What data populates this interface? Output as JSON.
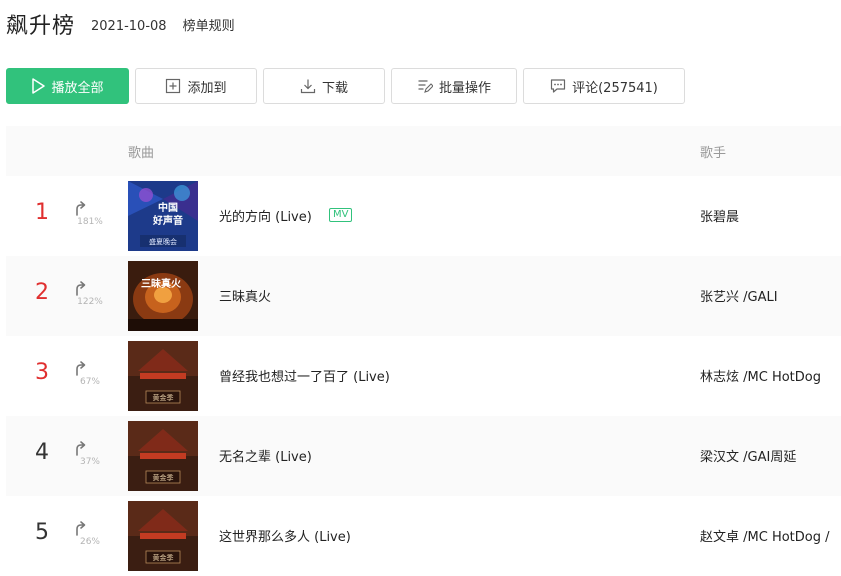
{
  "header": {
    "title": "飙升榜",
    "date": "2021-10-08",
    "rules_label": "榜单规则"
  },
  "toolbar": {
    "play_all": "播放全部",
    "add_to": "添加到",
    "download": "下载",
    "batch": "批量操作",
    "comment": "评论(257541)"
  },
  "list": {
    "col_song": "歌曲",
    "col_artist": "歌手",
    "rows": [
      {
        "rank": "1",
        "pct": "181%",
        "title": "光的方向 (Live)",
        "mv": "MV",
        "artist": "张碧晨"
      },
      {
        "rank": "2",
        "pct": "122%",
        "title": "三昧真火",
        "mv": "",
        "artist": "张艺兴 /GALI"
      },
      {
        "rank": "3",
        "pct": "67%",
        "title": "曾经我也想过一了百了 (Live)",
        "mv": "",
        "artist": "林志炫 /MC HotDog"
      },
      {
        "rank": "4",
        "pct": "37%",
        "title": "无名之辈 (Live)",
        "mv": "",
        "artist": "梁汉文 /GAI周延"
      },
      {
        "rank": "5",
        "pct": "26%",
        "title": "这世界那么多人 (Live)",
        "mv": "",
        "artist": "赵文卓 /MC HotDog /"
      }
    ]
  },
  "covers": {
    "cover1_text_1": "中国",
    "cover1_text_2": "好声音",
    "cover1_text_3": "盛夏晚会",
    "cover2_text": "三昧真火",
    "cover3_text": "黄金季"
  },
  "colors": {
    "accent": "#31c27c",
    "top_rank": "#e02f2f"
  },
  "icons": [
    "play-icon",
    "add-icon",
    "download-icon",
    "batch-icon",
    "comment-icon",
    "trend-up-icon"
  ]
}
